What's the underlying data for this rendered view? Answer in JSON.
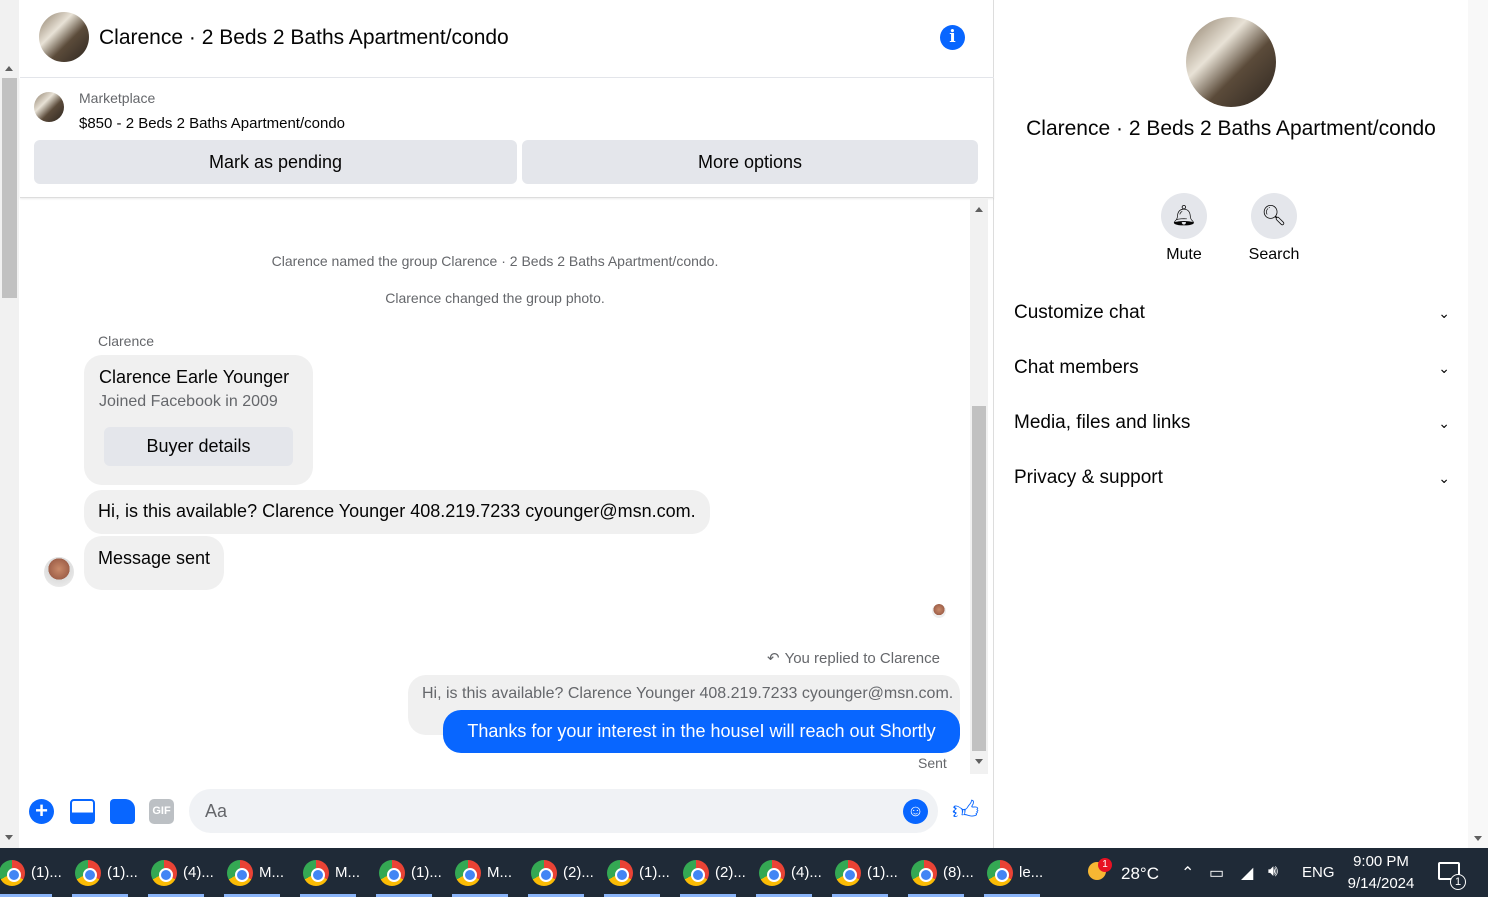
{
  "chat_header": {
    "title": "Clarence · 2 Beds 2 Baths Apartment/condo"
  },
  "marketplace": {
    "label": "Marketplace",
    "listing": "$850 - 2 Beds 2 Baths Apartment/condo",
    "mark_pending": "Mark as pending",
    "more_options": "More options"
  },
  "messages": {
    "system": [
      "Clarence named the group Clarence · 2 Beds 2 Baths Apartment/condo.",
      "Clarence changed the group photo."
    ],
    "sender_name": "Clarence",
    "profile_card": {
      "name": "Clarence Earle Younger",
      "joined": "Joined Facebook in 2009",
      "button": "Buyer details"
    },
    "incoming": [
      "Hi, is this available? Clarence Younger 408.219.7233 cyounger@msn.com.",
      "Message sent"
    ],
    "reply_note": "You replied to Clarence",
    "quoted": "Hi, is this available? Clarence Younger 408.219.7233 cyounger@msn.com.",
    "outgoing": "Thanks for your interest in the houseI will reach out Shortly",
    "status": "Sent"
  },
  "composer": {
    "placeholder": "Aa",
    "gif_label": "GIF"
  },
  "info_panel": {
    "name": "Clarence · 2 Beds 2 Baths Apartment/condo",
    "mute": "Mute",
    "search": "Search",
    "sections": [
      "Customize chat",
      "Chat members",
      "Media, files and links",
      "Privacy & support"
    ]
  },
  "taskbar": {
    "items": [
      "(1)...",
      "(1)...",
      "(4)...",
      "M...",
      "M...",
      "(1)...",
      "M...",
      "(2)...",
      "(1)...",
      "(2)...",
      "(4)...",
      "(1)...",
      "(8)...",
      "le..."
    ],
    "weather_badge": "1",
    "temperature": "28°C",
    "language": "ENG",
    "time": "9:00 PM",
    "date": "9/14/2024",
    "notifications": "1"
  },
  "colors": {
    "accent": "#0866ff",
    "taskbar": "#1f2a37"
  }
}
